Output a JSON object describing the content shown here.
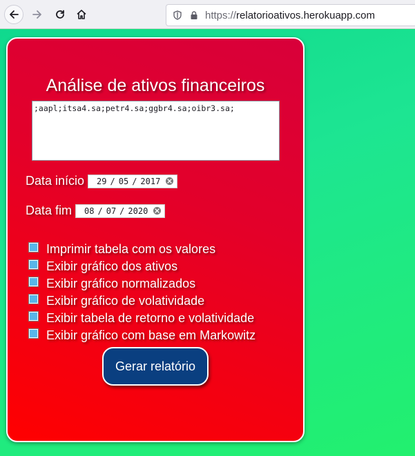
{
  "browser": {
    "url_scheme": "https://",
    "url_host": "relatorioativos.herokuapp.com",
    "icons": [
      "back-arrow-icon",
      "forward-arrow-icon",
      "reload-icon",
      "home-icon",
      "shield-icon",
      "lock-icon"
    ]
  },
  "form": {
    "title": "Análise de ativos financeiros",
    "tickers_value": ";aapl;itsa4.sa;petr4.sa;ggbr4.sa;oibr3.sa;",
    "start_date": {
      "label": "Data início",
      "day": "29",
      "month": "05",
      "year": "2017"
    },
    "end_date": {
      "label": "Data fim",
      "day": "08",
      "month": "07",
      "year": "2020"
    },
    "options": [
      {
        "label": "Imprimir tabela com os valores",
        "checked": true
      },
      {
        "label": "Exibir gráfico dos ativos",
        "checked": true
      },
      {
        "label": "Exibir gráfico normalizados",
        "checked": true
      },
      {
        "label": "Exibir gráfico de volatividade",
        "checked": true
      },
      {
        "label": "Exibir tabela de retorno e volatividade",
        "checked": true
      },
      {
        "label": "Exibir gráfico com base em Markowitz",
        "checked": true
      }
    ],
    "submit_label": "Gerar relatório"
  },
  "colors": {
    "card_gradient_top": "#d8003a",
    "card_gradient_bottom": "#ff0000",
    "page_background": "#1de592",
    "button_background": "#0a3f80",
    "checkbox_fill": "#58b6e8"
  }
}
